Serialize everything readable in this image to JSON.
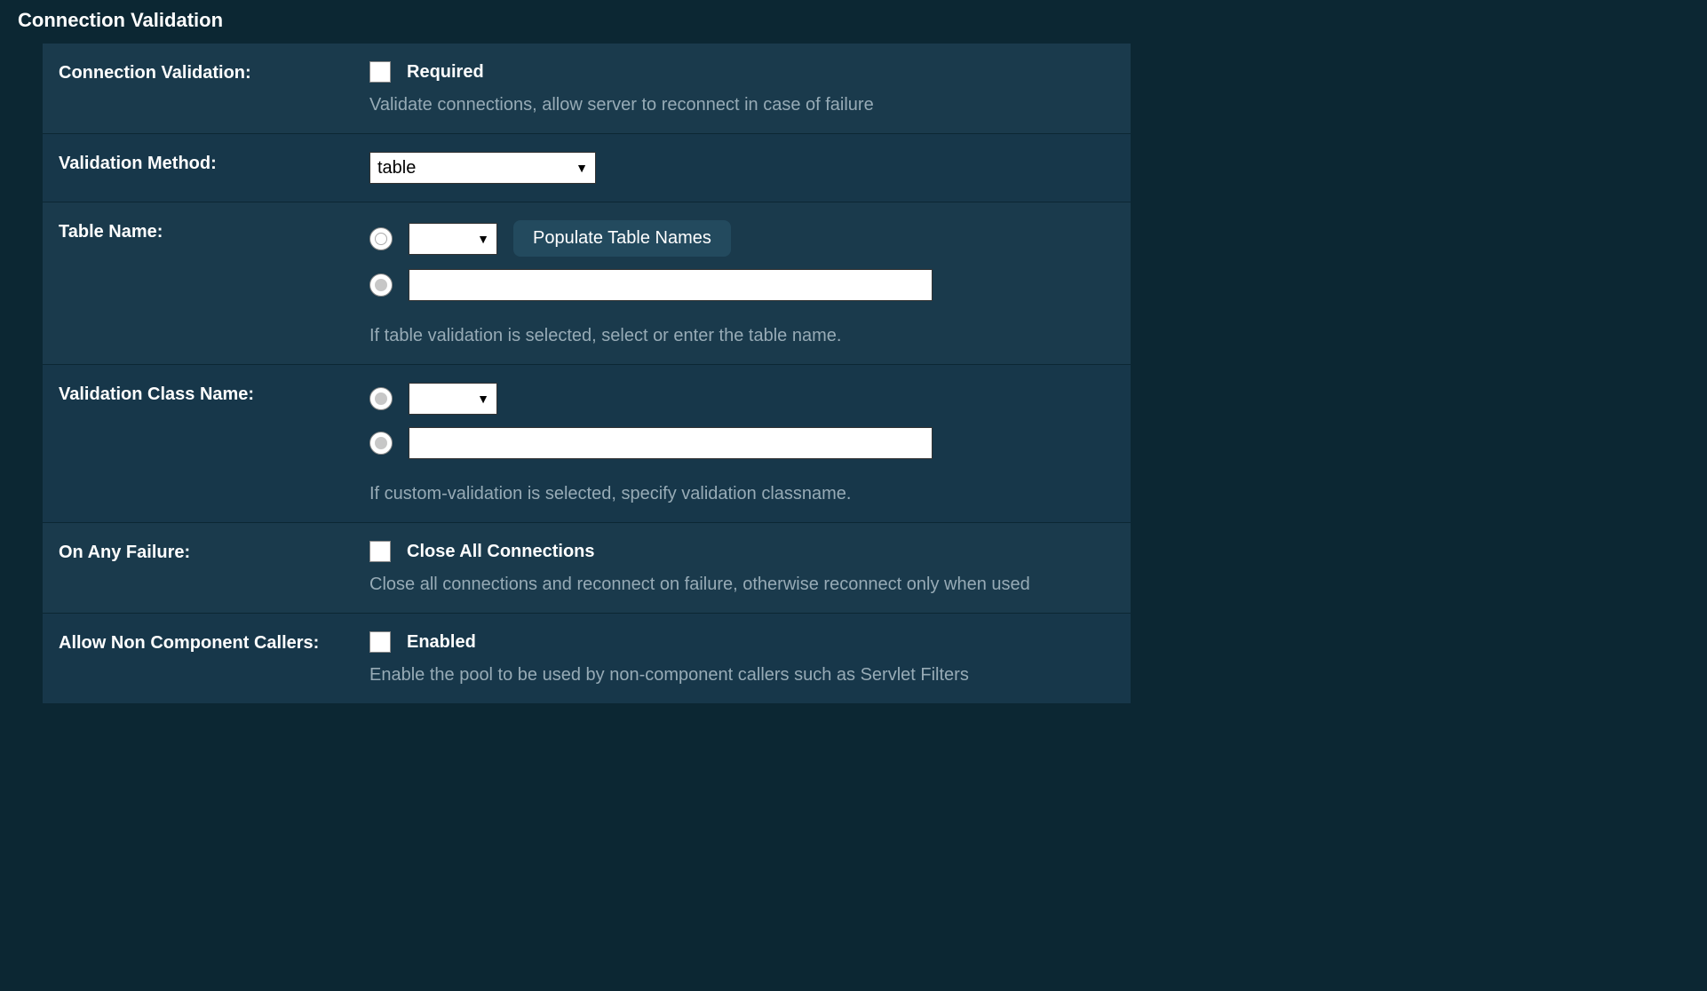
{
  "section": {
    "title": "Connection Validation"
  },
  "rows": {
    "connection_validation": {
      "label": "Connection Validation:",
      "checkbox_label": "Required",
      "hint": "Validate connections, allow server to reconnect in case of failure"
    },
    "validation_method": {
      "label": "Validation Method:",
      "value": "table"
    },
    "table_name": {
      "label": "Table Name:",
      "populate_button": "Populate Table Names",
      "hint": "If table validation is selected, select or enter the table name."
    },
    "validation_class_name": {
      "label": "Validation Class Name:",
      "hint": "If custom-validation is selected, specify validation classname."
    },
    "on_any_failure": {
      "label": "On Any Failure:",
      "checkbox_label": "Close All Connections",
      "hint": "Close all connections and reconnect on failure, otherwise reconnect only when used"
    },
    "allow_non_component": {
      "label": "Allow Non Component Callers:",
      "checkbox_label": "Enabled",
      "hint": "Enable the pool to be used by non-component callers such as Servlet Filters"
    }
  }
}
